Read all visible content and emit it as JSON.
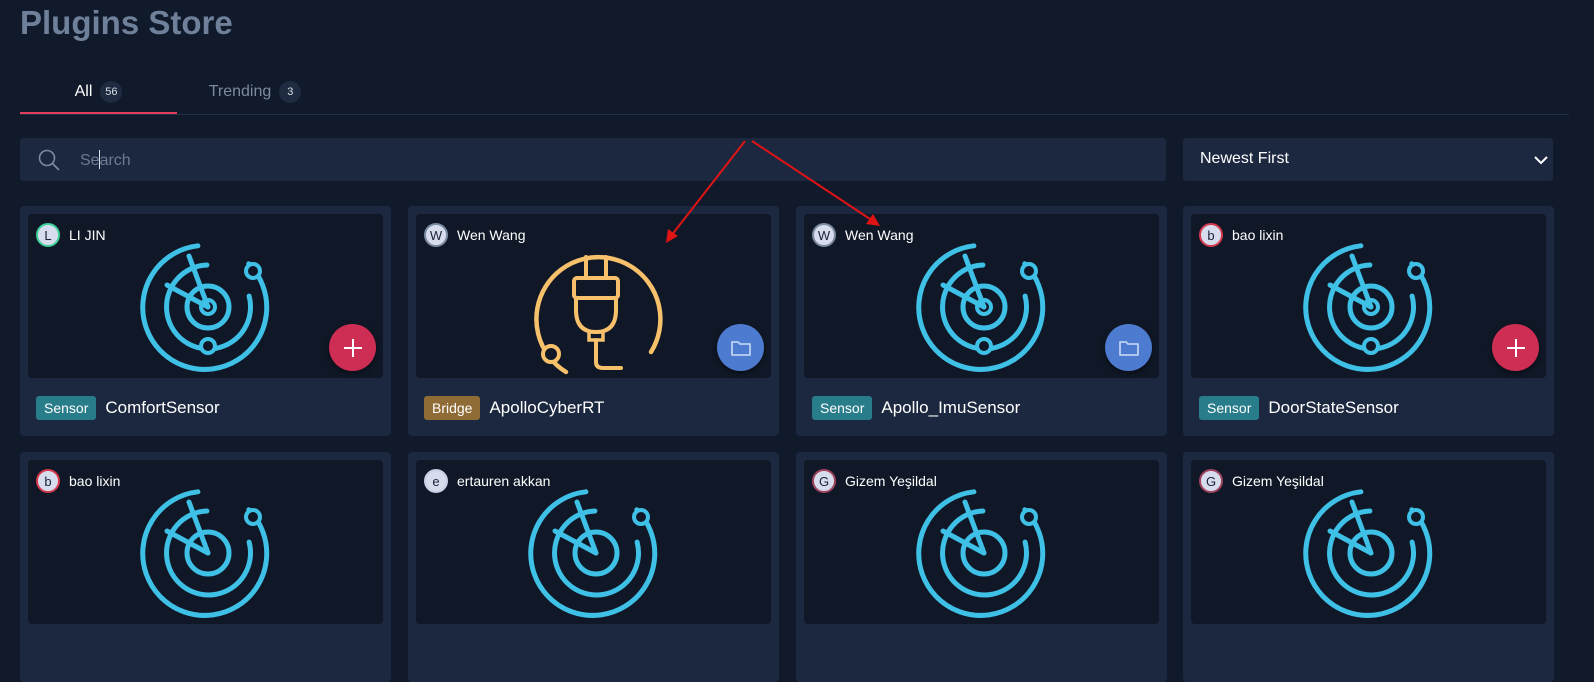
{
  "page": {
    "title": "Plugins Store"
  },
  "tabs": [
    {
      "label": "All",
      "count": "56"
    },
    {
      "label": "Trending",
      "count": "3"
    }
  ],
  "search": {
    "placeholder": "Search",
    "value": ""
  },
  "sort": {
    "selected": "Newest First"
  },
  "cards": [
    {
      "avatar": "L",
      "avatar_color": "#3ed19a",
      "author": "LI JIN",
      "category": "Sensor",
      "name": "ComfortSensor",
      "icon": "radar-icon",
      "action": "add-icon"
    },
    {
      "avatar": "W",
      "avatar_color": "#7a8aa0",
      "author": "Wen Wang",
      "category": "Bridge",
      "name": "ApolloCyberRT",
      "icon": "plug-icon",
      "action": "folder-icon"
    },
    {
      "avatar": "W",
      "avatar_color": "#7a8aa0",
      "author": "Wen Wang",
      "category": "Sensor",
      "name": "Apollo_ImuSensor",
      "icon": "radar-icon",
      "action": "folder-icon"
    },
    {
      "avatar": "b",
      "avatar_color": "#d33a4e",
      "author": "bao lixin",
      "category": "Sensor",
      "name": "DoorStateSensor",
      "icon": "radar-icon",
      "action": "add-icon"
    },
    {
      "avatar": "b",
      "avatar_color": "#d33a4e",
      "author": "bao lixin",
      "icon": "radar-icon"
    },
    {
      "avatar": "e",
      "avatar_color": "#c8cfe6",
      "author": "ertauren akkan",
      "icon": "radar-icon"
    },
    {
      "avatar": "G",
      "avatar_color": "#a04460",
      "author": "Gizem Yeşildal",
      "icon": "radar-icon"
    },
    {
      "avatar": "G",
      "avatar_color": "#a04460",
      "author": "Gizem Yeşildal",
      "icon": "radar-icon"
    }
  ],
  "colors": {
    "accent": "#e0405e",
    "radar": "#3fc0e6",
    "plug": "#f7c06a",
    "annotation": "#e01414"
  }
}
